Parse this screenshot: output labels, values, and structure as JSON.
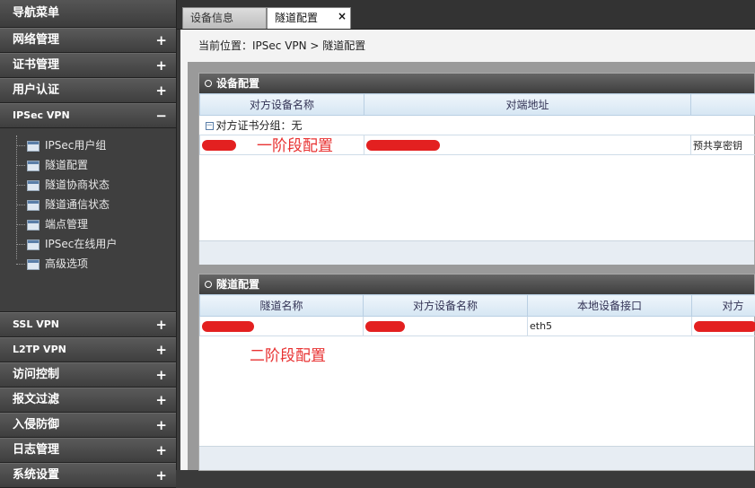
{
  "sidebar": {
    "title": "导航菜单",
    "sections_top": [
      {
        "label": "网络管理",
        "toggle": "+"
      },
      {
        "label": "证书管理",
        "toggle": "+"
      },
      {
        "label": "用户认证",
        "toggle": "+"
      },
      {
        "label": "IPSec VPN",
        "toggle": "−"
      }
    ],
    "tree_items": [
      {
        "label": "IPSec用户组"
      },
      {
        "label": "隧道配置"
      },
      {
        "label": "隧道协商状态"
      },
      {
        "label": "隧道通信状态"
      },
      {
        "label": "端点管理"
      },
      {
        "label": "IPSec在线用户"
      },
      {
        "label": "高级选项"
      }
    ],
    "sections_bottom": [
      {
        "label": "SSL VPN",
        "toggle": "+"
      },
      {
        "label": "L2TP VPN",
        "toggle": "+"
      },
      {
        "label": "访问控制",
        "toggle": "+"
      },
      {
        "label": "报文过滤",
        "toggle": "+"
      },
      {
        "label": "入侵防御",
        "toggle": "+"
      },
      {
        "label": "日志管理",
        "toggle": "+"
      },
      {
        "label": "系统设置",
        "toggle": "+"
      }
    ]
  },
  "tabs": [
    {
      "label": "设备信息",
      "active": false
    },
    {
      "label": "隧道配置",
      "active": true,
      "close": "×"
    }
  ],
  "breadcrumb": "当前位置：IPSec VPN > 隧道配置",
  "device_panel": {
    "title": "设备配置",
    "columns": [
      "对方设备名称",
      "对端地址",
      ""
    ],
    "group_label": "对方证书分组：无",
    "row": [
      "",
      "",
      "预共享密钥"
    ],
    "annotation": "一阶段配置"
  },
  "tunnel_panel": {
    "title": "隧道配置",
    "columns": [
      "隧道名称",
      "对方设备名称",
      "本地设备接口",
      "对方"
    ],
    "row": [
      "",
      "",
      "eth5",
      ""
    ],
    "annotation": "二阶段配置"
  },
  "colors": {
    "redaction": "#e32020",
    "annotation": "#e83232",
    "header_bg": "#d6e6f3"
  }
}
